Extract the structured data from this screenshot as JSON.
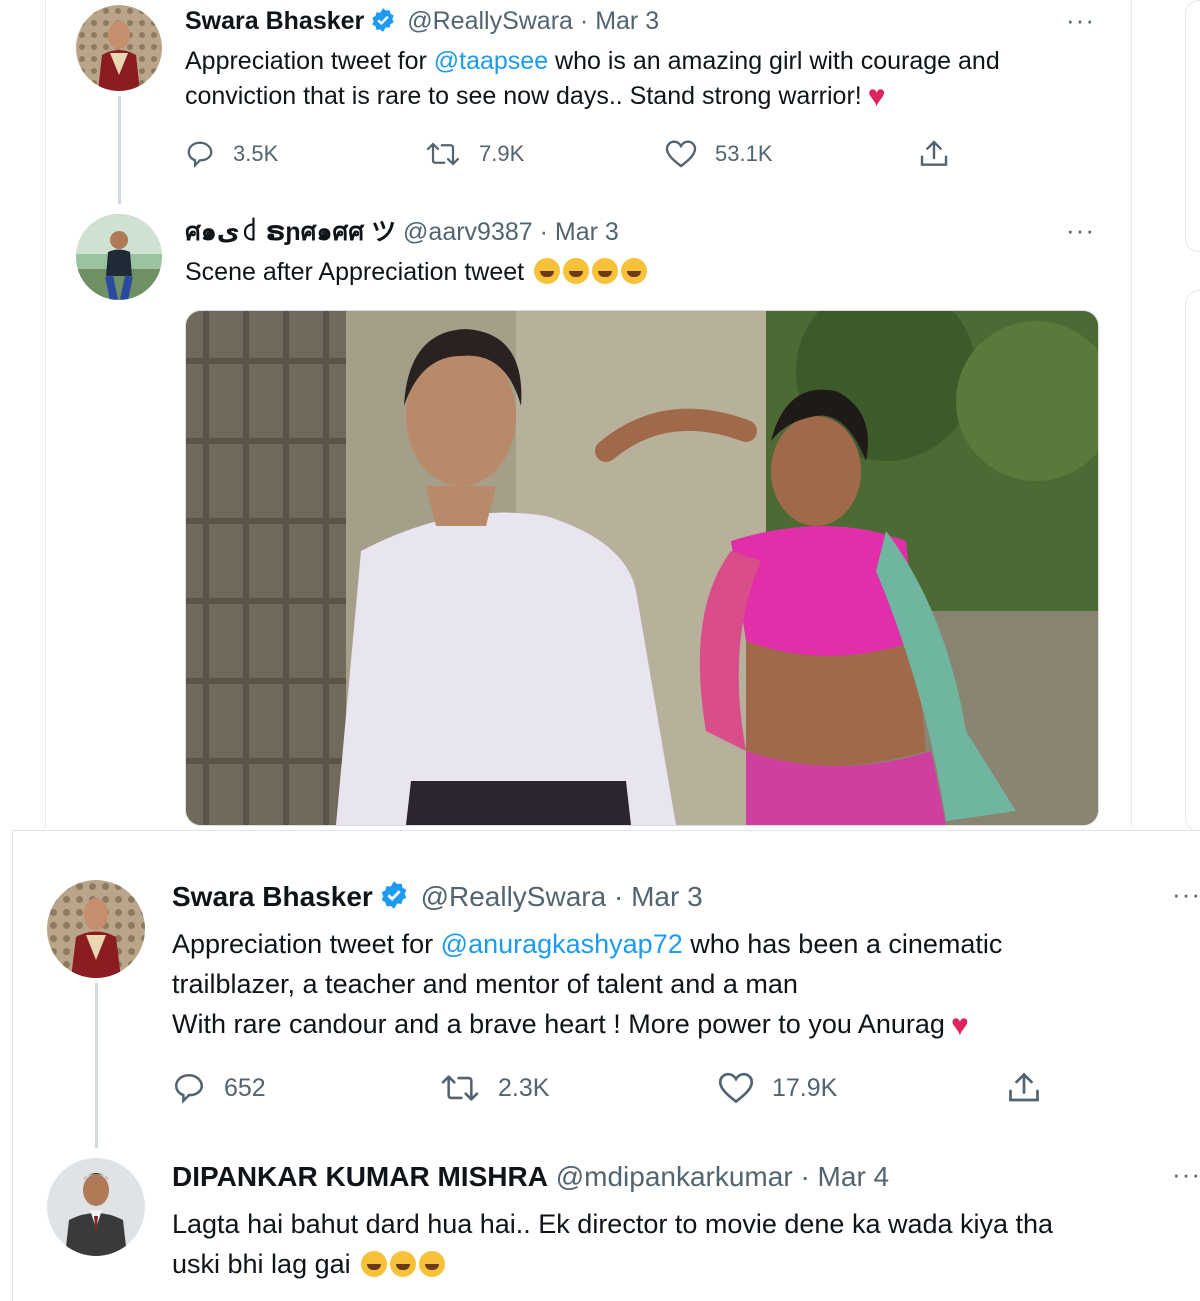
{
  "tweets": [
    {
      "name": "Swara Bhasker",
      "handle": "@ReallySwara",
      "date": "Mar 3",
      "text_pre": "Appreciation tweet for ",
      "mention": "@taapsee",
      "text_post": " who is an amazing girl with courage and",
      "line2": "conviction that is rare to see now days.. Stand strong warrior!",
      "replies": "3.5K",
      "retweets": "7.9K",
      "likes": "53.1K"
    },
    {
      "name": "ศ๑ﻯ꒯ ຣɲศ๑ศศ ツ",
      "handle": "@aarv9387",
      "date": "Mar 3",
      "text": "Scene after Appreciation tweet"
    },
    {
      "name": "Swara Bhasker",
      "handle": "@ReallySwara",
      "date": "Mar 3",
      "text_pre": "Appreciation tweet for ",
      "mention": "@anuragkashyap72",
      "text_post": " who has been a cinematic",
      "line2": "trailblazer, a teacher and mentor of talent and a man",
      "line3": "With rare candour and a brave heart ! More power to you Anurag",
      "replies": "652",
      "retweets": "2.3K",
      "likes": "17.9K"
    },
    {
      "name": "DIPANKAR KUMAR MISHRA",
      "handle": "@mdipankarkumar",
      "date": "Mar 4",
      "line1": "Lagta hai bahut dard hua hai.. Ek director to movie dene ka wada kiya tha",
      "line2": "uski bhi lag gai"
    }
  ],
  "sep": "·",
  "more": "···",
  "colors": {
    "accent": "#1d9bf0",
    "text": "#0f1419",
    "muted": "#536471",
    "heart": "#e0245e"
  },
  "icons": [
    "verified-badge-icon",
    "reply-icon",
    "retweet-icon",
    "like-icon",
    "share-icon",
    "more-icon"
  ]
}
